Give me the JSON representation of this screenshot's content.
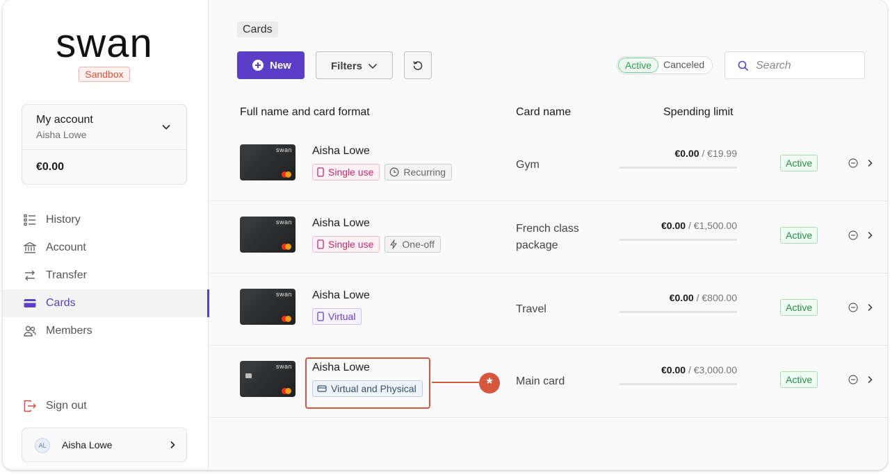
{
  "sidebar": {
    "logo_text": "swan",
    "env_badge": "Sandbox",
    "account": {
      "title": "My account",
      "owner": "Aisha Lowe",
      "balance": "€0.00"
    },
    "nav": [
      {
        "label": "History",
        "icon": "list-icon"
      },
      {
        "label": "Account",
        "icon": "bank-icon"
      },
      {
        "label": "Transfer",
        "icon": "arrows-icon"
      },
      {
        "label": "Cards",
        "icon": "card-icon",
        "active": true
      },
      {
        "label": "Members",
        "icon": "users-icon"
      }
    ],
    "sign_out": "Sign out",
    "user": {
      "initials": "AL",
      "name": "Aisha Lowe"
    }
  },
  "main": {
    "breadcrumb": "Cards",
    "toolbar": {
      "new_label": "New",
      "filters_label": "Filters",
      "status_active": "Active",
      "status_canceled": "Canceled",
      "search_placeholder": "Search"
    },
    "columns": {
      "full_name": "Full name and card format",
      "card_name": "Card name",
      "spending_limit": "Spending limit"
    },
    "rows": [
      {
        "holder": "Aisha Lowe",
        "tags": [
          {
            "label": "Single use",
            "style": "pink",
            "icon": "phone-icon"
          },
          {
            "label": "Recurring",
            "style": "gray",
            "icon": "clock-icon"
          }
        ],
        "card_name": "Gym",
        "spent": "€0.00",
        "limit": "/ €19.99",
        "spent_fraction": 0,
        "status": "Active"
      },
      {
        "holder": "Aisha Lowe",
        "tags": [
          {
            "label": "Single use",
            "style": "pink",
            "icon": "phone-icon"
          },
          {
            "label": "One-off",
            "style": "gray",
            "icon": "bolt-icon"
          }
        ],
        "card_name": "French class package",
        "spent": "€0.00",
        "limit": "/ €1,500.00",
        "spent_fraction": 0,
        "status": "Active"
      },
      {
        "holder": "Aisha Lowe",
        "tags": [
          {
            "label": "Virtual",
            "style": "violet",
            "icon": "phone-icon"
          }
        ],
        "card_name": "Travel",
        "spent": "€0.00",
        "limit": "/ €800.00",
        "spent_fraction": 0,
        "status": "Active"
      },
      {
        "holder": "Aisha Lowe",
        "tags": [
          {
            "label": "Virtual and Physical",
            "style": "blue",
            "icon": "card-icon"
          }
        ],
        "card_name": "Main card",
        "spent": "€0.00",
        "limit": "/ €3,000.00",
        "spent_fraction": 0,
        "status": "Active",
        "highlighted": true
      }
    ],
    "card_brand": "swan",
    "annotation_marker": "*",
    "colors": {
      "accent": "#5a3ec8",
      "annotation": "#d5573f",
      "active_green": "#2a8a4a"
    }
  }
}
